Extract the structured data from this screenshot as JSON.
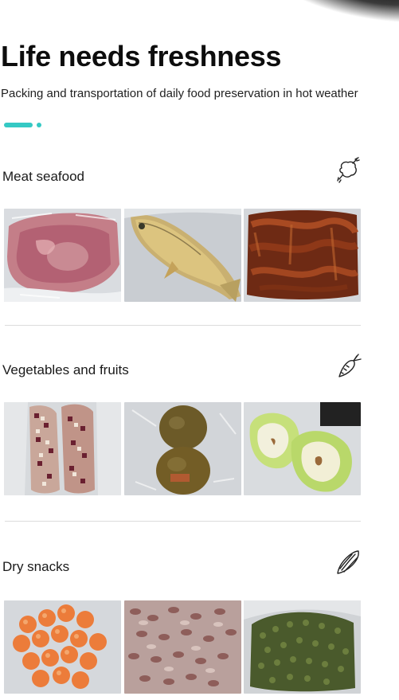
{
  "header": {
    "title": "Life needs freshness",
    "subtitle": "Packing and transportation of daily food preservation in hot weather",
    "accent_color": "#35c9c4"
  },
  "sections": [
    {
      "title": "Meat seafood",
      "icon": "meat-icon",
      "images": [
        "vacuum-packed-pork-image",
        "vacuum-packed-fish-image",
        "vacuum-packed-sausage-image"
      ]
    },
    {
      "title": "Vegetables and fruits",
      "icon": "carrot-icon",
      "images": [
        "vacuum-packed-corn-image",
        "vacuum-packed-kiwi-image",
        "vacuum-packed-pear-image"
      ]
    },
    {
      "title": "Dry snacks",
      "icon": "sunflower-seed-icon",
      "images": [
        "vacuum-packed-candy-image",
        "vacuum-packed-beans-image",
        "vacuum-packed-green-beans-image"
      ]
    }
  ]
}
